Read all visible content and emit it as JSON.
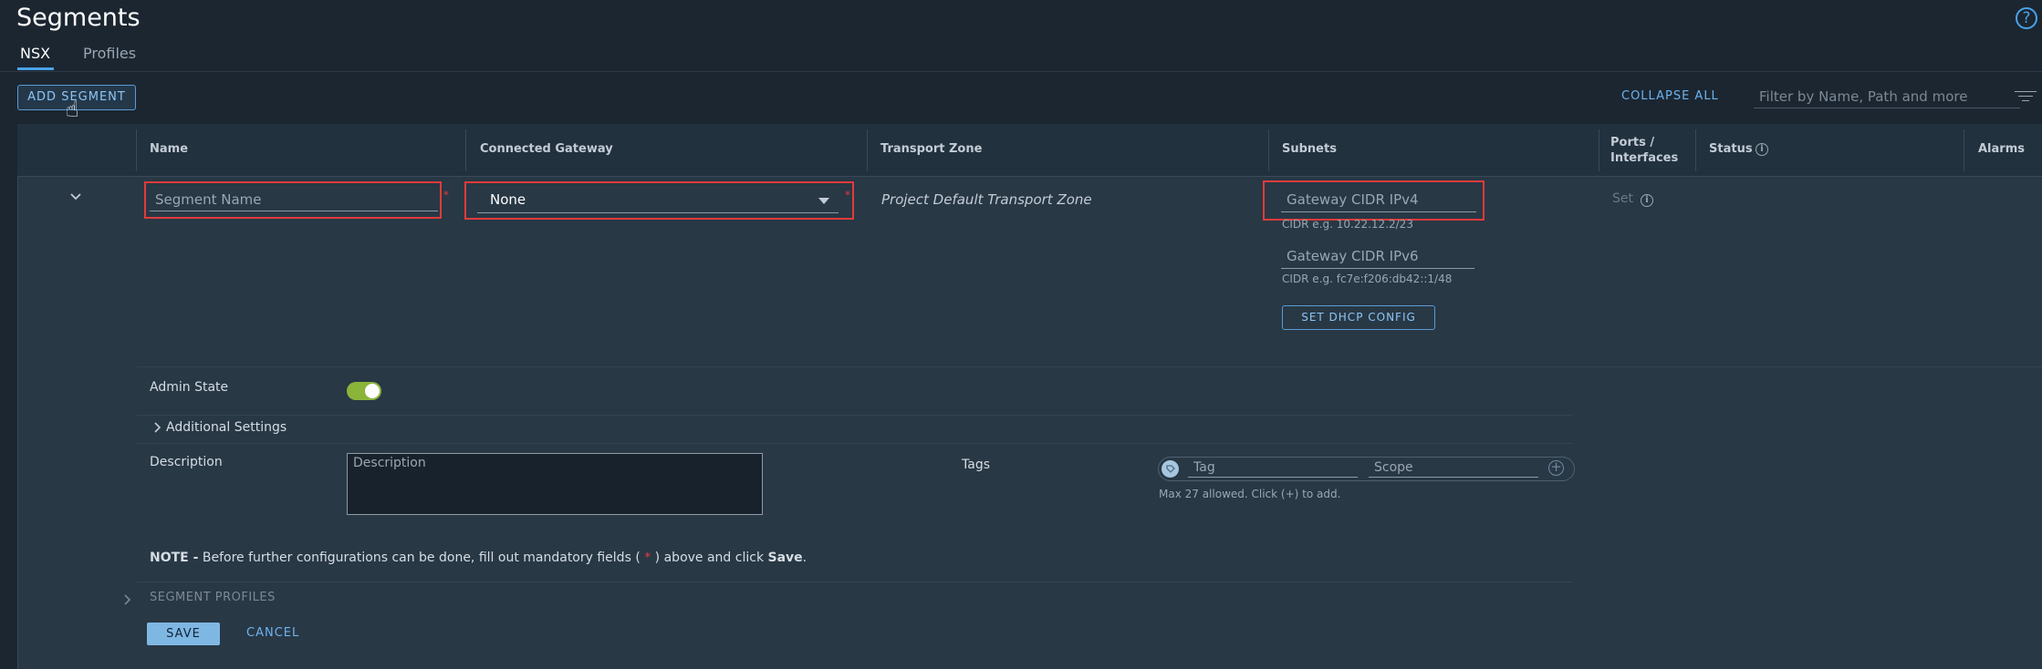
{
  "page": {
    "title": "Segments"
  },
  "tabs": [
    {
      "label": "NSX",
      "active": true
    },
    {
      "label": "Profiles",
      "active": false
    }
  ],
  "toolbar": {
    "add_label": "ADD SEGMENT",
    "collapse_label": "COLLAPSE ALL",
    "filter_placeholder": "Filter by Name, Path and more"
  },
  "columns": {
    "name": "Name",
    "gateway": "Connected Gateway",
    "transport": "Transport Zone",
    "subnets": "Subnets",
    "ports_line1": "Ports /",
    "ports_line2": "Interfaces",
    "status": "Status",
    "alarms": "Alarms"
  },
  "form": {
    "segment_name_placeholder": "Segment Name",
    "gateway_value": "None",
    "transport_zone": "Project Default Transport Zone",
    "ipv4_placeholder": "Gateway CIDR IPv4",
    "ipv4_hint": "CIDR e.g. 10.22.12.2/23",
    "ipv6_placeholder": "Gateway CIDR IPv6",
    "ipv6_hint": "CIDR e.g. fc7e:f206:db42::1/48",
    "dhcp_label": "SET DHCP CONFIG",
    "status_set": "Set",
    "required_mark": "*",
    "admin_state_label": "Admin State",
    "admin_state_on": true,
    "additional_settings": "Additional Settings",
    "description_label": "Description",
    "description_placeholder": "Description",
    "tags_label": "Tags",
    "tag_placeholder": "Tag",
    "scope_placeholder": "Scope",
    "tags_hint": "Max 27 allowed. Click (+) to add.",
    "note_prefix": "NOTE -",
    "note_body": " Before further configurations can be done, fill out mandatory fields ( ",
    "note_star": "*",
    "note_mid": " ) above and click ",
    "note_save": "Save",
    "note_end": ".",
    "segment_profiles": "SEGMENT PROFILES",
    "save_label": "SAVE",
    "cancel_label": "CANCEL"
  },
  "colors": {
    "accent": "#4aa3e8",
    "error": "#e13b3b",
    "toggle_on": "#8bb43b"
  }
}
